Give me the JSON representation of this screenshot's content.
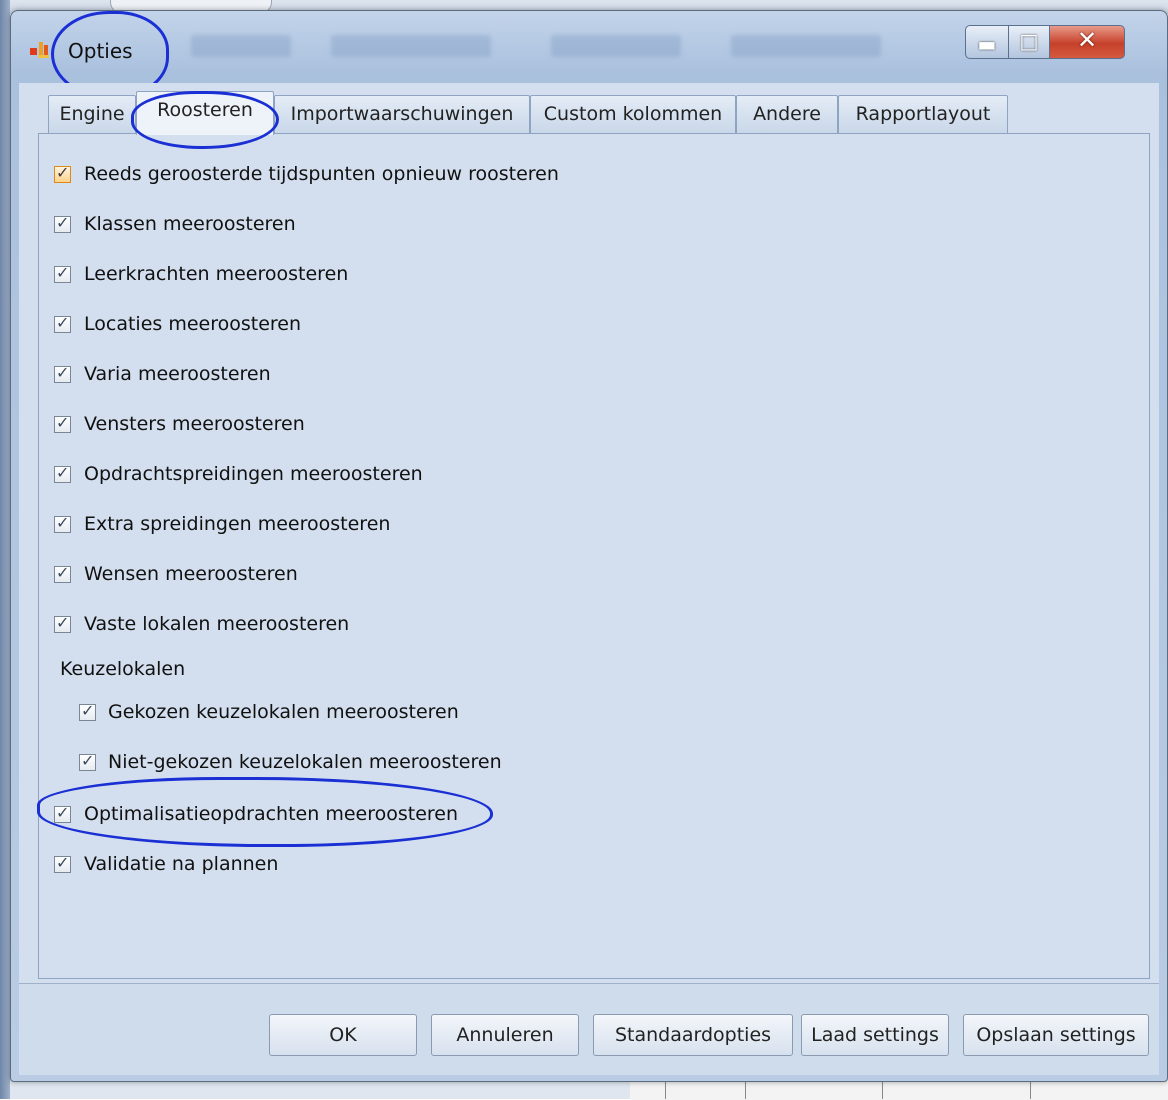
{
  "window": {
    "title": "Opties"
  },
  "tabs": [
    {
      "label": "Engine",
      "active": false
    },
    {
      "label": "Roosteren",
      "active": true
    },
    {
      "label": "Importwaarschuwingen",
      "active": false
    },
    {
      "label": "Custom kolommen",
      "active": false
    },
    {
      "label": "Andere",
      "active": false
    },
    {
      "label": "Rapportlayout",
      "active": false
    }
  ],
  "options": [
    {
      "label": "Reeds geroosterde tijdspunten opnieuw roosteren",
      "checked": true
    },
    {
      "label": "Klassen meeroosteren",
      "checked": true
    },
    {
      "label": "Leerkrachten meeroosteren",
      "checked": true
    },
    {
      "label": "Locaties meeroosteren",
      "checked": true
    },
    {
      "label": "Varia meeroosteren",
      "checked": true
    },
    {
      "label": "Vensters meeroosteren",
      "checked": true
    },
    {
      "label": "Opdrachtspreidingen meeroosteren",
      "checked": true
    },
    {
      "label": "Extra spreidingen meeroosteren",
      "checked": true
    },
    {
      "label": "Wensen meeroosteren",
      "checked": true
    },
    {
      "label": "Vaste lokalen meeroosteren",
      "checked": true
    }
  ],
  "keuzelokalen": {
    "label": "Keuzelokalen",
    "items": [
      {
        "label": "Gekozen keuzelokalen meeroosteren",
        "checked": true
      },
      {
        "label": "Niet-gekozen keuzelokalen meeroosteren",
        "checked": true
      }
    ]
  },
  "extra_options": [
    {
      "label": "Optimalisatieopdrachten meeroosteren",
      "checked": true
    },
    {
      "label": "Validatie na plannen",
      "checked": true
    }
  ],
  "buttons": {
    "ok": "OK",
    "cancel": "Annuleren",
    "defaults": "Standaardopties",
    "load": "Laad settings",
    "save": "Opslaan settings"
  },
  "colors": {
    "annotation": "#1a2fd4",
    "focus_checkbox": "#ffd28a"
  }
}
